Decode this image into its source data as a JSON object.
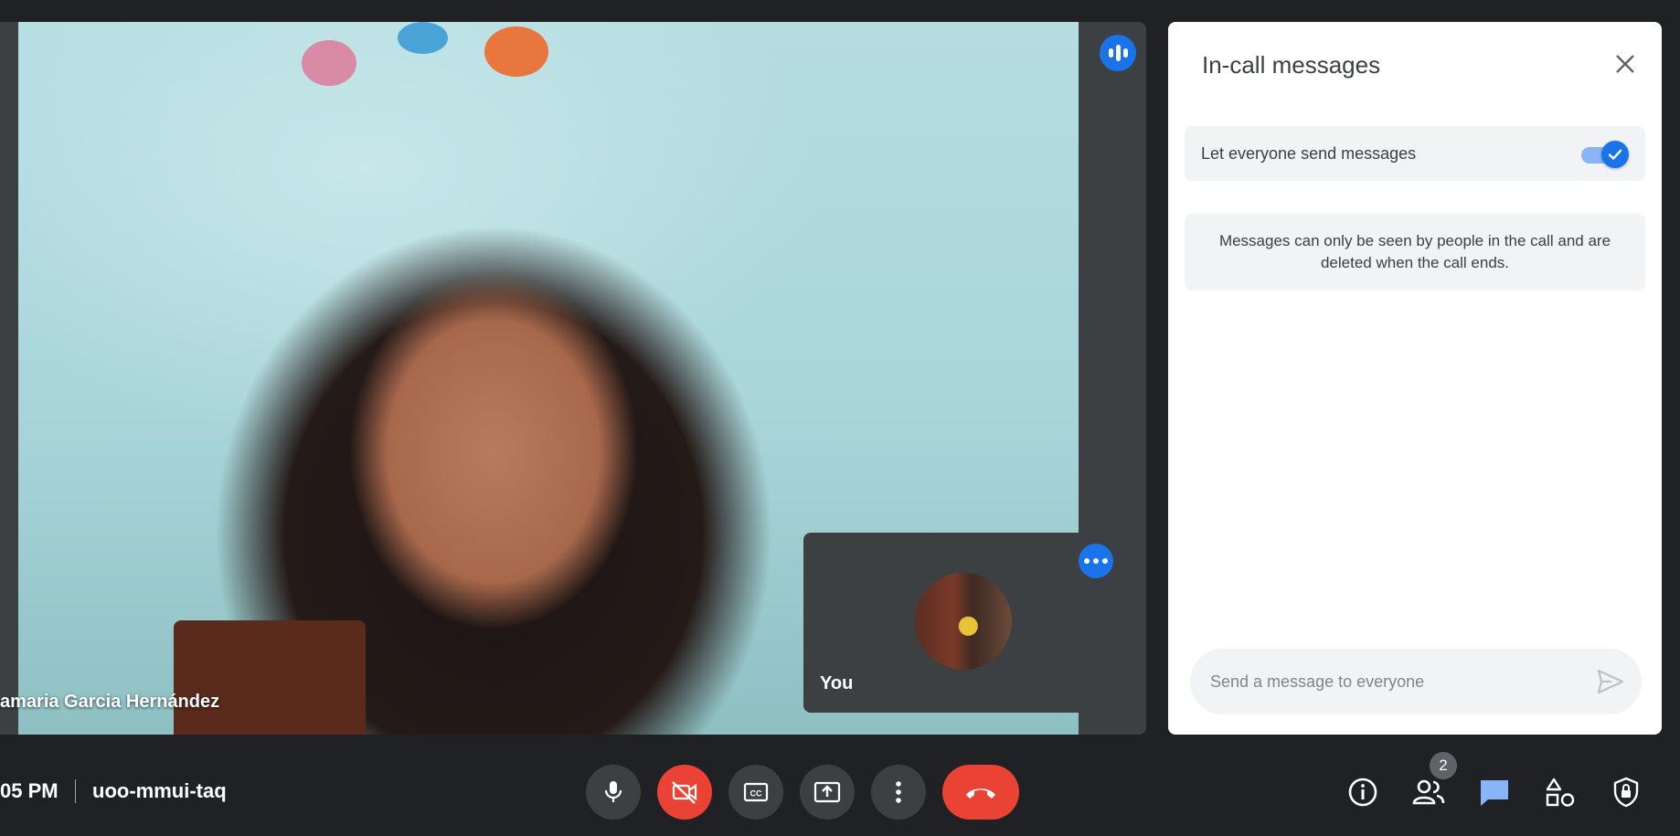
{
  "stage": {
    "speaker_name": "amaria Garcia Hernández",
    "self_tile": {
      "label": "You"
    }
  },
  "panel": {
    "title": "In-call messages",
    "setting_label": "Let everyone send messages",
    "setting_enabled": true,
    "info": "Messages can only be seen by people in the call and are deleted when the call ends.",
    "input_placeholder": "Send a message to everyone"
  },
  "bottom_bar": {
    "time": "05 PM",
    "meeting_code": "uoo-mmui-taq",
    "participants_count": "2"
  },
  "icons": {
    "mic": "microphone-icon",
    "camera": "camera-off-icon",
    "captions": "captions-icon",
    "present": "present-screen-icon",
    "more": "more-vertical-icon",
    "hangup": "hang-up-icon",
    "info": "info-icon",
    "people": "people-icon",
    "chat": "chat-icon",
    "activities": "activities-icon",
    "host": "host-controls-icon"
  },
  "colors": {
    "accent": "#1a73e8",
    "danger": "#ea4335",
    "background": "#202124",
    "chat_active": "#8ab4f8"
  }
}
